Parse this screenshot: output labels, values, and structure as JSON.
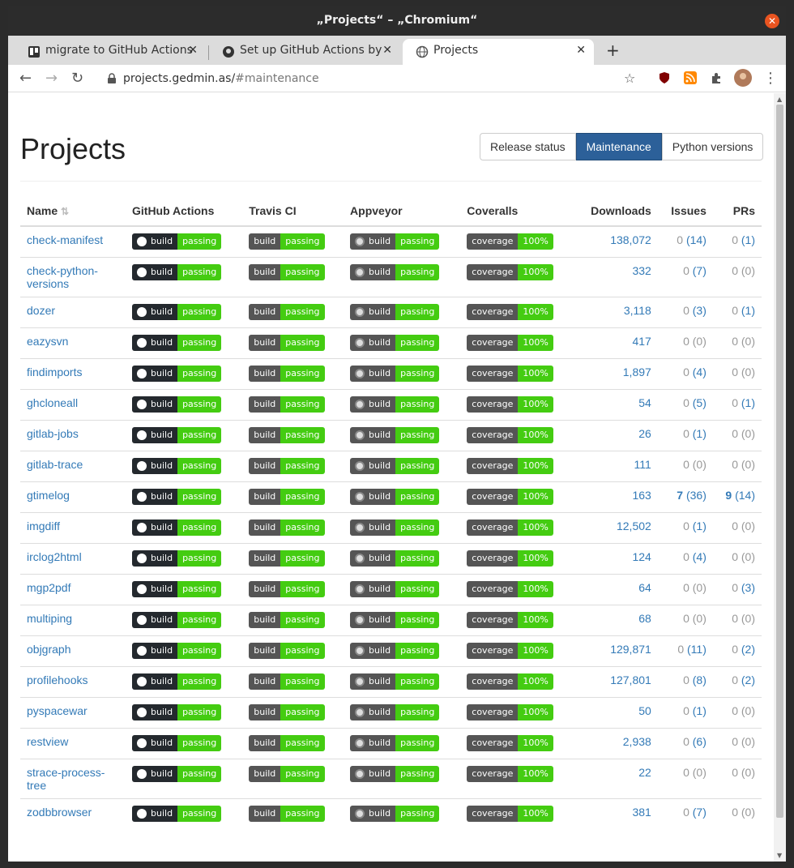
{
  "window": {
    "title": "„Projects“ – „Chromium“"
  },
  "tabs": [
    {
      "label": "migrate to GitHub Actions",
      "icon": "trello-icon"
    },
    {
      "label": "Set up GitHub Actions by",
      "icon": "github-icon"
    },
    {
      "label": "Projects",
      "icon": "globe-icon"
    }
  ],
  "address": {
    "host": "projects.gedmin.as/",
    "path": "#maintenance"
  },
  "page": {
    "title": "Projects",
    "views": [
      "Release status",
      "Maintenance",
      "Python versions"
    ],
    "active_view": "Maintenance"
  },
  "table": {
    "headers": [
      "Name",
      "GitHub Actions",
      "Travis CI",
      "Appveyor",
      "Coveralls",
      "Downloads",
      "Issues",
      "PRs"
    ],
    "badges": {
      "build": "build",
      "passing": "passing",
      "coverage": "coverage",
      "pct": "100%"
    },
    "rows": [
      {
        "name": "check-manifest",
        "downloads": "138,072",
        "issues_open": "0",
        "issues_all": "(14)",
        "prs_open": "0",
        "prs_all": "(1)"
      },
      {
        "name": "check-python-versions",
        "downloads": "332",
        "issues_open": "0",
        "issues_all": "(7)",
        "prs_open": "0",
        "prs_all": "(0)"
      },
      {
        "name": "dozer",
        "downloads": "3,118",
        "issues_open": "0",
        "issues_all": "(3)",
        "prs_open": "0",
        "prs_all": "(1)"
      },
      {
        "name": "eazysvn",
        "downloads": "417",
        "issues_open": "0",
        "issues_all": "(0)",
        "prs_open": "0",
        "prs_all": "(0)"
      },
      {
        "name": "findimports",
        "downloads": "1,897",
        "issues_open": "0",
        "issues_all": "(4)",
        "prs_open": "0",
        "prs_all": "(0)"
      },
      {
        "name": "ghcloneall",
        "downloads": "54",
        "issues_open": "0",
        "issues_all": "(5)",
        "prs_open": "0",
        "prs_all": "(1)"
      },
      {
        "name": "gitlab-jobs",
        "downloads": "26",
        "issues_open": "0",
        "issues_all": "(1)",
        "prs_open": "0",
        "prs_all": "(0)"
      },
      {
        "name": "gitlab-trace",
        "downloads": "111",
        "issues_open": "0",
        "issues_all": "(0)",
        "prs_open": "0",
        "prs_all": "(0)"
      },
      {
        "name": "gtimelog",
        "downloads": "163",
        "issues_open": "7",
        "issues_all": "(36)",
        "prs_open": "9",
        "prs_all": "(14)"
      },
      {
        "name": "imgdiff",
        "downloads": "12,502",
        "issues_open": "0",
        "issues_all": "(1)",
        "prs_open": "0",
        "prs_all": "(0)"
      },
      {
        "name": "irclog2html",
        "downloads": "124",
        "issues_open": "0",
        "issues_all": "(4)",
        "prs_open": "0",
        "prs_all": "(0)"
      },
      {
        "name": "mgp2pdf",
        "downloads": "64",
        "issues_open": "0",
        "issues_all": "(0)",
        "prs_open": "0",
        "prs_all": "(3)"
      },
      {
        "name": "multiping",
        "downloads": "68",
        "issues_open": "0",
        "issues_all": "(0)",
        "prs_open": "0",
        "prs_all": "(0)"
      },
      {
        "name": "objgraph",
        "downloads": "129,871",
        "issues_open": "0",
        "issues_all": "(11)",
        "prs_open": "0",
        "prs_all": "(2)"
      },
      {
        "name": "profilehooks",
        "downloads": "127,801",
        "issues_open": "0",
        "issues_all": "(8)",
        "prs_open": "0",
        "prs_all": "(2)"
      },
      {
        "name": "pyspacewar",
        "downloads": "50",
        "issues_open": "0",
        "issues_all": "(1)",
        "prs_open": "0",
        "prs_all": "(0)"
      },
      {
        "name": "restview",
        "downloads": "2,938",
        "issues_open": "0",
        "issues_all": "(6)",
        "prs_open": "0",
        "prs_all": "(0)"
      },
      {
        "name": "strace-process-tree",
        "downloads": "22",
        "issues_open": "0",
        "issues_all": "(0)",
        "prs_open": "0",
        "prs_all": "(0)"
      },
      {
        "name": "zodbbrowser",
        "downloads": "381",
        "issues_open": "0",
        "issues_all": "(7)",
        "prs_open": "0",
        "prs_all": "(0)"
      }
    ]
  }
}
